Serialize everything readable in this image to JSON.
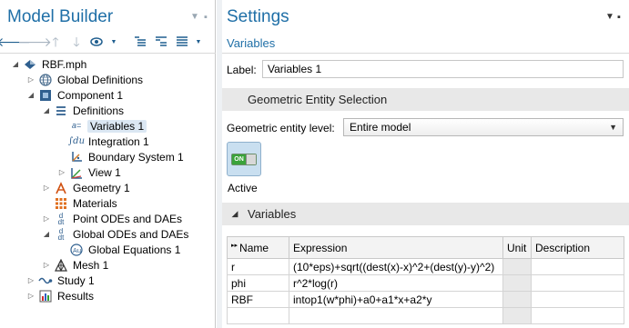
{
  "left_panel": {
    "title": "Model Builder",
    "tree": [
      {
        "label": "RBF.mph",
        "icon": "model-icon",
        "depth": 0,
        "twisty": "open"
      },
      {
        "label": "Global Definitions",
        "icon": "globe-icon",
        "depth": 1,
        "twisty": "closed"
      },
      {
        "label": "Component 1",
        "icon": "component-icon",
        "depth": 1,
        "twisty": "open"
      },
      {
        "label": "Definitions",
        "icon": "definitions-icon",
        "depth": 2,
        "twisty": "open"
      },
      {
        "label": "Variables 1",
        "icon": "variables-icon",
        "depth": 3,
        "twisty": "none",
        "selected": true
      },
      {
        "label": "Integration 1",
        "icon": "integration-icon",
        "depth": 3,
        "twisty": "none"
      },
      {
        "label": "Boundary System 1",
        "icon": "boundary-system-icon",
        "depth": 3,
        "twisty": "none"
      },
      {
        "label": "View 1",
        "icon": "view-icon",
        "depth": 3,
        "twisty": "closed"
      },
      {
        "label": "Geometry 1",
        "icon": "geometry-icon",
        "depth": 2,
        "twisty": "closed"
      },
      {
        "label": "Materials",
        "icon": "materials-icon",
        "depth": 2,
        "twisty": "none"
      },
      {
        "label": "Point ODEs and DAEs",
        "icon": "ode-icon",
        "depth": 2,
        "twisty": "closed"
      },
      {
        "label": "Global ODEs and DAEs",
        "icon": "ode-icon",
        "depth": 2,
        "twisty": "open"
      },
      {
        "label": "Global Equations 1",
        "icon": "global-equations-icon",
        "depth": 3,
        "twisty": "none"
      },
      {
        "label": "Mesh 1",
        "icon": "mesh-icon",
        "depth": 2,
        "twisty": "closed"
      },
      {
        "label": "Study 1",
        "icon": "study-icon",
        "depth": 1,
        "twisty": "closed"
      },
      {
        "label": "Results",
        "icon": "results-icon",
        "depth": 1,
        "twisty": "closed"
      }
    ]
  },
  "settings": {
    "title": "Settings",
    "subtitle": "Variables",
    "label_field": {
      "label": "Label:",
      "value": "Variables 1"
    },
    "geometric_section": {
      "header": "Geometric Entity Selection"
    },
    "geometric_level": {
      "label": "Geometric entity level:",
      "value": "Entire model"
    },
    "active_toggle": {
      "state_text": "ON",
      "label": "Active"
    },
    "variables_section": {
      "header": "Variables"
    },
    "table": {
      "columns": [
        "Name",
        "Expression",
        "Unit",
        "Description"
      ],
      "rows": [
        {
          "name": "r",
          "expression": "(10*eps)+sqrt((dest(x)-x)^2+(dest(y)-y)^2)",
          "unit": "",
          "description": ""
        },
        {
          "name": "phi",
          "expression": "r^2*log(r)",
          "unit": "",
          "description": ""
        },
        {
          "name": "RBF",
          "expression": "intop1(w*phi)+a0+a1*x+a2*y",
          "unit": "",
          "description": ""
        },
        {
          "name": "",
          "expression": "",
          "unit": "",
          "description": ""
        }
      ]
    }
  }
}
